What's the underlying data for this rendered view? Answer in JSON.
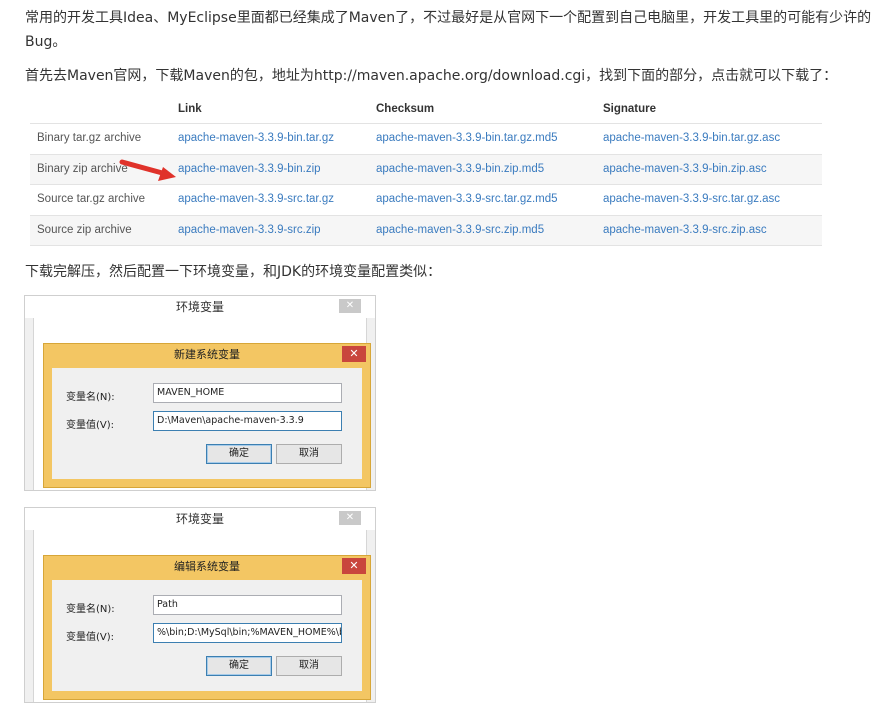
{
  "intro": {
    "p1": "常用的开发工具Idea、MyEclipse里面都已经集成了Maven了，不过最好是从官网下一个配置到自己电脑里，开发工具里的可能有少许的Bug。",
    "p2": "首先去Maven官网，下载Maven的包，地址为http://maven.apache.org/download.cgi，找到下面的部分，点击就可以下载了：",
    "p3": "下载完解压，然后配置一下环境变量，和JDK的环境变量配置类似："
  },
  "download_table": {
    "headers": [
      "Link",
      "Checksum",
      "Signature"
    ],
    "rows": [
      {
        "type": "Binary tar.gz archive",
        "link": "apache-maven-3.3.9-bin.tar.gz",
        "checksum": "apache-maven-3.3.9-bin.tar.gz.md5",
        "signature": "apache-maven-3.3.9-bin.tar.gz.asc"
      },
      {
        "type": "Binary zip archive",
        "link": "apache-maven-3.3.9-bin.zip",
        "checksum": "apache-maven-3.3.9-bin.zip.md5",
        "signature": "apache-maven-3.3.9-bin.zip.asc"
      },
      {
        "type": "Source tar.gz archive",
        "link": "apache-maven-3.3.9-src.tar.gz",
        "checksum": "apache-maven-3.3.9-src.tar.gz.md5",
        "signature": "apache-maven-3.3.9-src.tar.gz.asc"
      },
      {
        "type": "Source zip archive",
        "link": "apache-maven-3.3.9-src.zip",
        "checksum": "apache-maven-3.3.9-src.zip.md5",
        "signature": "apache-maven-3.3.9-src.zip.asc"
      }
    ]
  },
  "dialog1": {
    "outer_title": "环境变量",
    "outer_close": "✕",
    "stray_text": "    ",
    "title": "新建系统变量",
    "close": "✕",
    "name_label": "变量名(N):",
    "value_label": "变量值(V):",
    "name_value": "MAVEN_HOME",
    "value_value": "D:\\Maven\\apache-maven-3.3.9",
    "ok_label": "确定",
    "cancel_label": "取消"
  },
  "dialog2": {
    "outer_title": "环境变量",
    "outer_close": "✕",
    "stray_text": "    ",
    "title": "编辑系统变量",
    "close": "✕",
    "name_label": "变量名(N):",
    "value_label": "变量值(V):",
    "name_value": "Path",
    "value_value": "%\\bin;D:\\MySql\\bin;%MAVEN_HOME%\\bin",
    "ok_label": "确定",
    "cancel_label": "取消"
  },
  "colors": {
    "link": "#3a7bbf",
    "arrow": "#e0322a",
    "dialog_frame": "#f3c663",
    "dialog_close": "#c9463d"
  }
}
